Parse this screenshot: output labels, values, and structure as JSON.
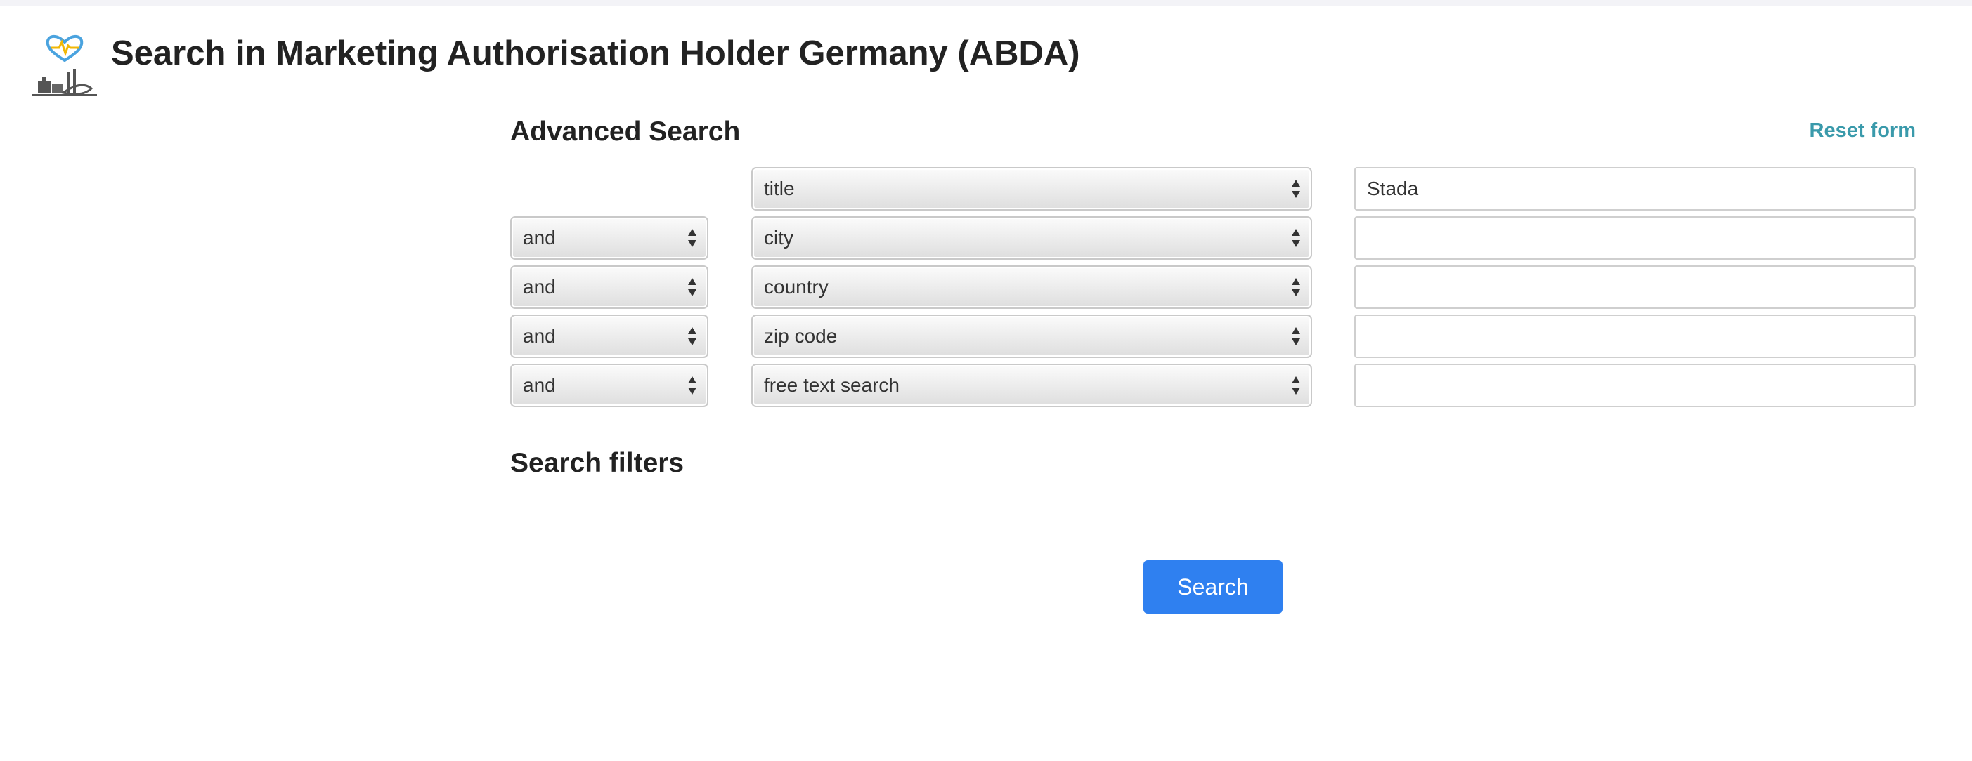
{
  "header": {
    "title": "Search in Marketing Authorisation Holder Germany (ABDA)",
    "logo_icon": "pharma-company-logo-icon",
    "accent_color": "#2f80f0"
  },
  "advanced_search": {
    "heading": "Advanced Search",
    "reset_label": "Reset form",
    "rows": [
      {
        "operator": "",
        "field": "title",
        "value": ""
      },
      {
        "operator": "and",
        "field": "city",
        "value": ""
      },
      {
        "operator": "and",
        "field": "country",
        "value": ""
      },
      {
        "operator": "and",
        "field": "zip code",
        "value": ""
      },
      {
        "operator": "and",
        "field": "free text search",
        "value": ""
      }
    ],
    "first_value": "Stada"
  },
  "filters": {
    "heading": "Search filters"
  },
  "actions": {
    "search_label": "Search"
  }
}
